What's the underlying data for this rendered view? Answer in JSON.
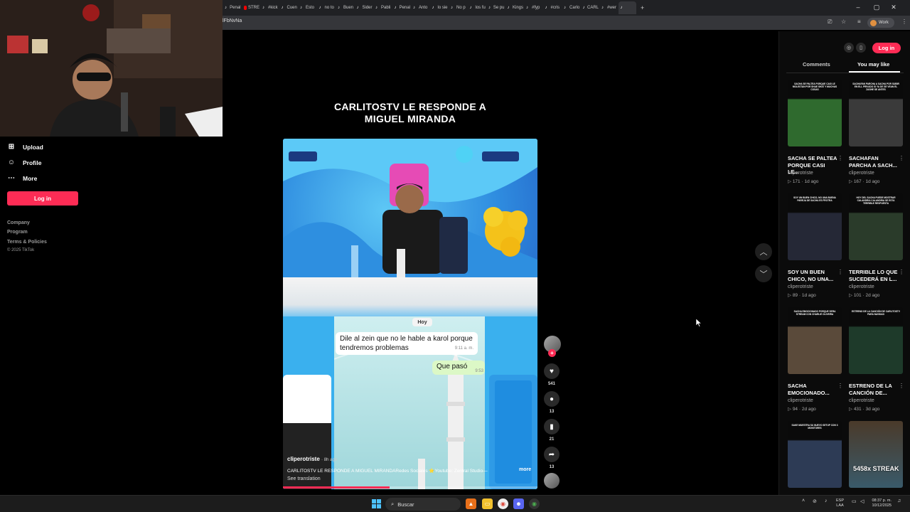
{
  "browser": {
    "tabs": [
      {
        "label": "Penal",
        "icon": "tiktok-icon"
      },
      {
        "label": "STRE",
        "icon": "youtube-icon"
      },
      {
        "label": "#kick",
        "icon": "tiktok-icon"
      },
      {
        "label": "Cuen",
        "icon": "tiktok-icon"
      },
      {
        "label": "Esto",
        "icon": "tiktok-icon"
      },
      {
        "label": "no to",
        "icon": "tiktok-icon"
      },
      {
        "label": "Buen",
        "icon": "tiktok-icon"
      },
      {
        "label": "Sider",
        "icon": "tiktok-icon"
      },
      {
        "label": "Pabli",
        "icon": "tiktok-icon"
      },
      {
        "label": "Penal",
        "icon": "tiktok-icon"
      },
      {
        "label": "Anto",
        "icon": "tiktok-icon"
      },
      {
        "label": "lo sie",
        "icon": "tiktok-icon"
      },
      {
        "label": "No p",
        "icon": "tiktok-icon"
      },
      {
        "label": "los fu",
        "icon": "tiktok-icon"
      },
      {
        "label": "Se pu",
        "icon": "tiktok-icon"
      },
      {
        "label": "Kings",
        "icon": "tiktok-icon"
      },
      {
        "label": "#fyp",
        "icon": "tiktok-icon"
      },
      {
        "label": "#cris",
        "icon": "tiktok-icon"
      },
      {
        "label": "Carlo",
        "icon": "tiktok-icon"
      },
      {
        "label": "CARL",
        "icon": "tiktok-icon"
      },
      {
        "label": "#wer",
        "icon": "tiktok-icon"
      },
      {
        "label": "",
        "icon": "tiktok-icon",
        "active": true
      }
    ],
    "new_tab": "+",
    "url_fragment": "lFbNvNa",
    "profile_label": "Work"
  },
  "sidebar": {
    "items": [
      {
        "label": "Upload",
        "icon": "plus-square-icon"
      },
      {
        "label": "Profile",
        "icon": "person-icon"
      },
      {
        "label": "More",
        "icon": "more-dots-icon"
      }
    ],
    "login_label": "Log in",
    "footer": [
      "Company",
      "Program",
      "Terms & Policies"
    ],
    "copyright": "© 2025 TikTok"
  },
  "video": {
    "title_line1": "CARLITOSTV LE RESPONDE A",
    "title_line2": "MIGUEL MIRANDA",
    "chat_day": "Hoy",
    "msg1": "Dile al zein que no le hable a karol porque tendremos problemas",
    "msg1_time": "9:11 a. m.",
    "msg2": "Que pasó",
    "msg2_time": "9:53",
    "author": "cliperotriste",
    "author_suffix": "· 8h ago",
    "description": "CARLITOSTV LE RESPONDE A MIGUEL MIRANDARedes Sociales ⭐Youtube: Zentral Studio—",
    "more_label": "more",
    "translation_label": "See translation",
    "progress": 0.42
  },
  "actions": {
    "likes": "541",
    "comments": "13",
    "saves": "21",
    "shares": "13"
  },
  "right_panel": {
    "login_label": "Log in",
    "tabs": [
      "Comments",
      "You may like"
    ],
    "active_tab": "You may like",
    "cards": [
      {
        "title": "SACHA SE PALTEA PORQUE CASI LE...",
        "author": "cliperotriste",
        "views": "171",
        "age": "1d ago",
        "caption": "SACHA SE PALTEA PORQUE CASI LE MOLESTAN POR SHAE SHAT Y MUCHAS COSAS",
        "thumb": "#2f6a2e"
      },
      {
        "title": "SACHAFAN PARCHA A SACH...",
        "author": "cliperotriste",
        "views": "167",
        "age": "1d ago",
        "caption": "SACHAFAN PARCHA A SACHA POR SUBIR EN ELL PRIVADO SI YA DE SE VEAN EL ZASHE SE ANTES",
        "thumb": "#3a3a3a"
      },
      {
        "title": "SOY UN BUEN CHICO, NO UNA...",
        "author": "cliperotriste",
        "views": "89",
        "age": "1d ago",
        "caption": "SOY UN BUEN CHICO, NO UNA BUENA PAREJA DE SACHA ES FROTRA",
        "thumb": "#252836"
      },
      {
        "title": "TERRIBLE LO QUE SUCEDERÁ EN L...",
        "author": "cliperotriste",
        "views": "101",
        "age": "2d ago",
        "caption": "HOY DEL SACHA PUEDE MOSTRAR CALANDRIA CALANDRIA SE ESTA TERRIBLE RESPUESTA",
        "thumb": "#2a3b2a"
      },
      {
        "title": "SACHA EMOCIONADO...",
        "author": "cliperotriste",
        "views": "94",
        "age": "2d ago",
        "caption": "SACHA EMOCIONADO PORQUE SERA STREAM CON CHARLIE OLIVEIRA",
        "thumb": "#5a4a3a"
      },
      {
        "title": "ESTRENO DE LA CANCIÓN DE...",
        "author": "cliperotriste",
        "views": "431",
        "age": "3d ago",
        "caption": "ESTRENO DE LA CANCIÓN DE CARLITOSTV PARA NAVIDAD",
        "thumb": "#1e3a2a"
      },
      {
        "title": "",
        "author": "",
        "views": "",
        "age": "",
        "caption": "SAKE MUESTRA SU NUEVO SETUP CON 3 MONITORES",
        "thumb": "#2d3b55"
      },
      {
        "title": "",
        "author": "",
        "views": "",
        "age": "",
        "caption": "",
        "thumb": "#3a5a6a",
        "overlay": "5458x STREAK"
      }
    ]
  },
  "taskbar": {
    "search_label": "Buscar",
    "lang_line1": "ESP",
    "lang_line2": "LAA",
    "time": "08:37 p. m.",
    "date": "10/12/2025"
  }
}
